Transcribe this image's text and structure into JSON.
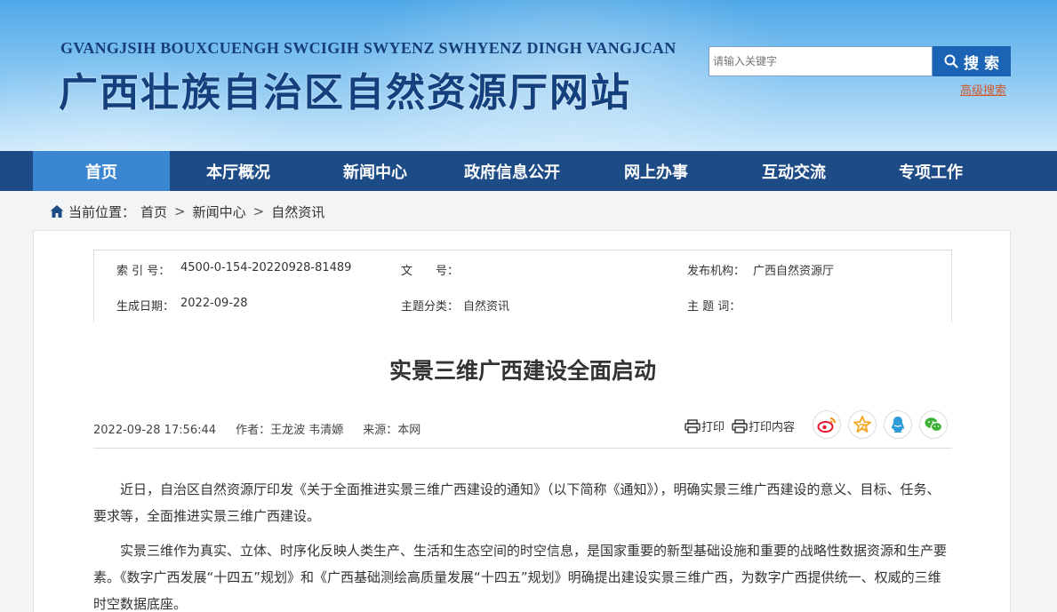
{
  "header": {
    "subtitle": "GVANGJSIH BOUXCUENGH SWCIGIH SWYENZ SWHYENZ DINGH VANGJCAN",
    "title": "广西壮族自治区自然资源厅网站",
    "search_placeholder": "请输入关键字",
    "search_button": "搜 索",
    "advanced_search": "高级搜索"
  },
  "nav": {
    "items": [
      {
        "label": "首页"
      },
      {
        "label": "本厅概况"
      },
      {
        "label": "新闻中心"
      },
      {
        "label": "政府信息公开"
      },
      {
        "label": "网上办事"
      },
      {
        "label": "互动交流"
      },
      {
        "label": "专项工作"
      }
    ],
    "active": "首页"
  },
  "breadcrumb": {
    "prefix": "当前位置：",
    "items": [
      "首页",
      "新闻中心",
      "自然资讯"
    ],
    "separator": ">"
  },
  "meta": {
    "index_label": "索 引 号：",
    "index_value": "4500-0-154-20220928-81489",
    "docno_label": "文　　号：",
    "docno_value": "",
    "publisher_label": "发布机构：",
    "publisher_value": "广西自然资源厅",
    "date_label": "生成日期：",
    "date_value": "2022-09-28",
    "category_label": "主题分类：",
    "category_value": "自然资讯",
    "keywords_label": "主 题 词：",
    "keywords_value": ""
  },
  "article": {
    "title": "实景三维广西建设全面启动",
    "datetime": "2022-09-28 17:56:44",
    "author_label": "作者：",
    "author": "王龙波 韦清嫄",
    "source_label": "来源：",
    "source": "本网",
    "print_label": "打印",
    "print_content_label": "打印内容",
    "paragraphs": [
      "近日，自治区自然资源厅印发《关于全面推进实景三维广西建设的通知》（以下简称《通知》），明确实景三维广西建设的意义、目标、任务、要求等，全面推进实景三维广西建设。",
      "实景三维作为真实、立体、时序化反映人类生产、生活和生态空间的时空信息，是国家重要的新型基础设施和重要的战略性数据资源和生产要素。《数字广西发展“十四五”规划》和《广西基础测绘高质量发展“十四五”规划》明确提出建设实景三维广西，为数字广西提供统一、权威的三维时空数据底座。"
    ]
  },
  "share": {
    "icons": [
      "weibo-icon",
      "favorite-star-icon",
      "qq-icon",
      "wechat-icon"
    ],
    "colors": {
      "weibo": "#e6162d",
      "star": "#f5a623",
      "qq": "#2c9bd7",
      "wechat": "#3cb034"
    }
  },
  "colors": {
    "nav_bg": "#1c4b85",
    "nav_active": "#3a86d0",
    "title_blue": "#14407e",
    "search_button": "#1a63b5",
    "advanced_search": "#d2582a"
  }
}
